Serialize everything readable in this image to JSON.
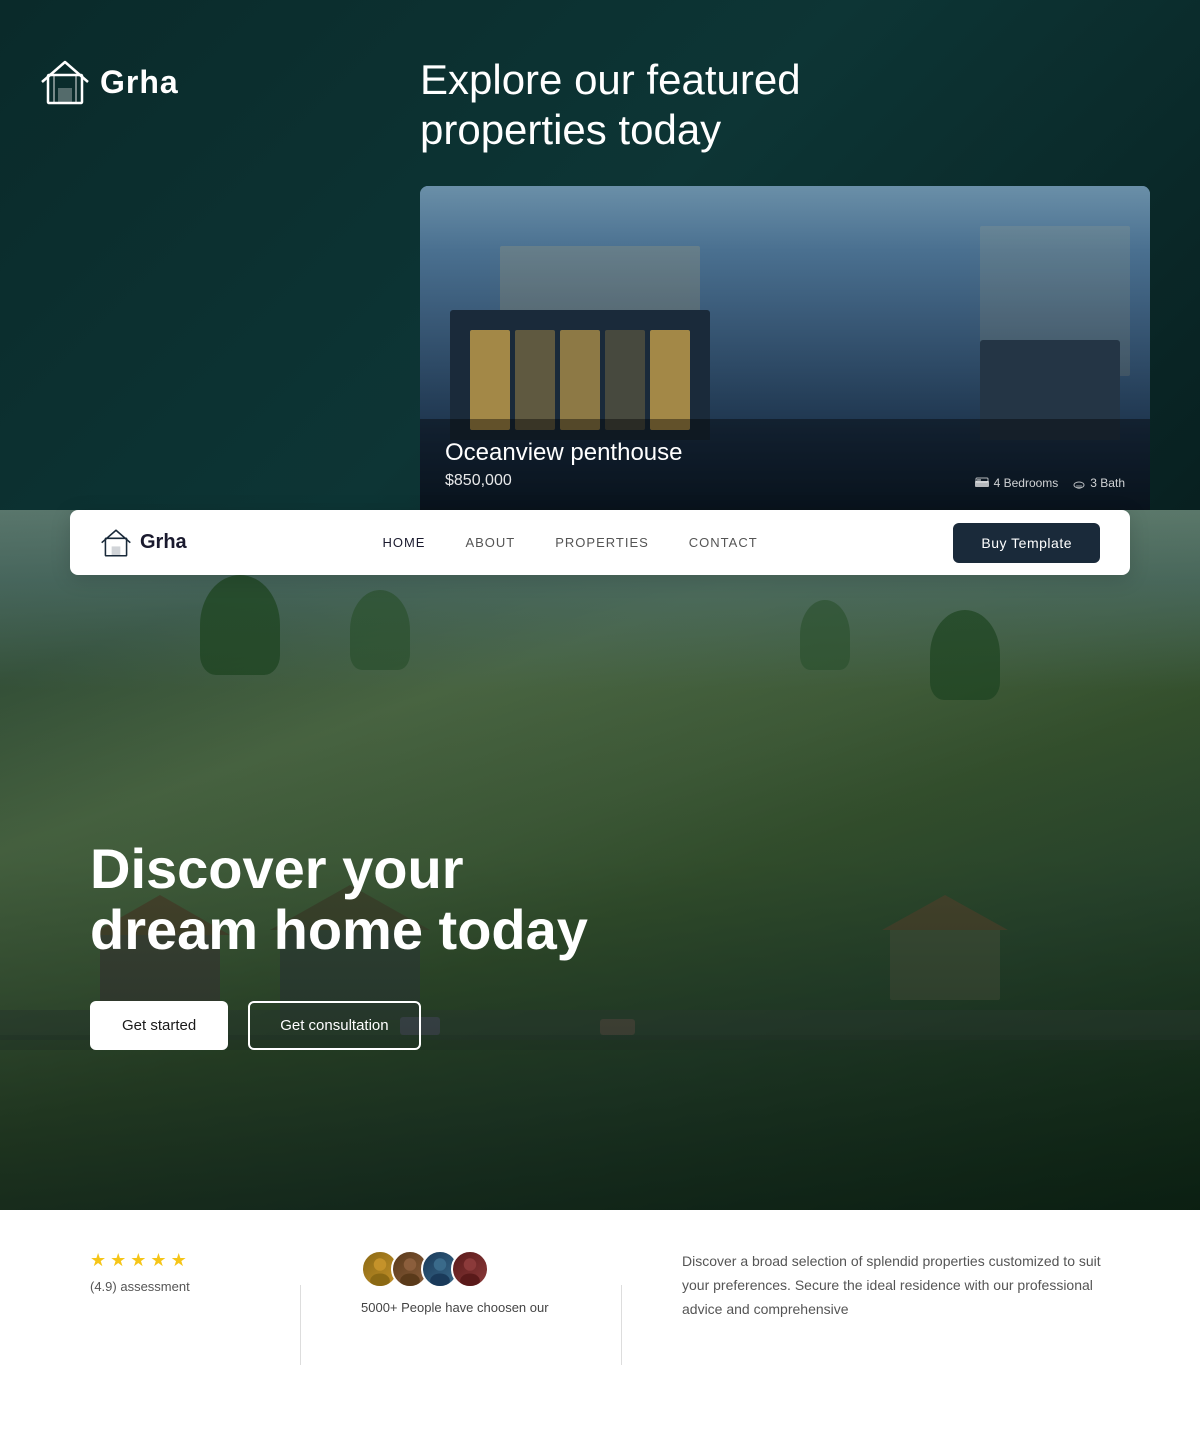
{
  "brand": {
    "name": "Grha",
    "logo_alt": "Grha logo"
  },
  "top_section": {
    "heading_line1": "Explore our featured",
    "heading_line2": "properties today",
    "property": {
      "name": "Oceanview penthouse",
      "price": "$850,000",
      "bedrooms": "4 Bedrooms",
      "bathrooms": "3 Bath"
    }
  },
  "navbar": {
    "logo_name": "Grha",
    "links": [
      {
        "label": "HOME",
        "active": true
      },
      {
        "label": "ABOUT",
        "active": false
      },
      {
        "label": "PROPERTIES",
        "active": false
      },
      {
        "label": "CONTACT",
        "active": false
      }
    ],
    "buy_button": "Buy Template"
  },
  "hero": {
    "title_line1": "Discover your",
    "title_line2": "dream home today",
    "cta_primary": "Get started",
    "cta_secondary": "Get consultation"
  },
  "bottom": {
    "rating_stars": "★★★★★",
    "rating_label": "(4.9) assessment",
    "users_count": "5000+ People have choosen our",
    "description": "Discover a broad selection of splendid properties customized to suit your preferences. Secure the ideal residence with our professional advice and comprehensive"
  }
}
